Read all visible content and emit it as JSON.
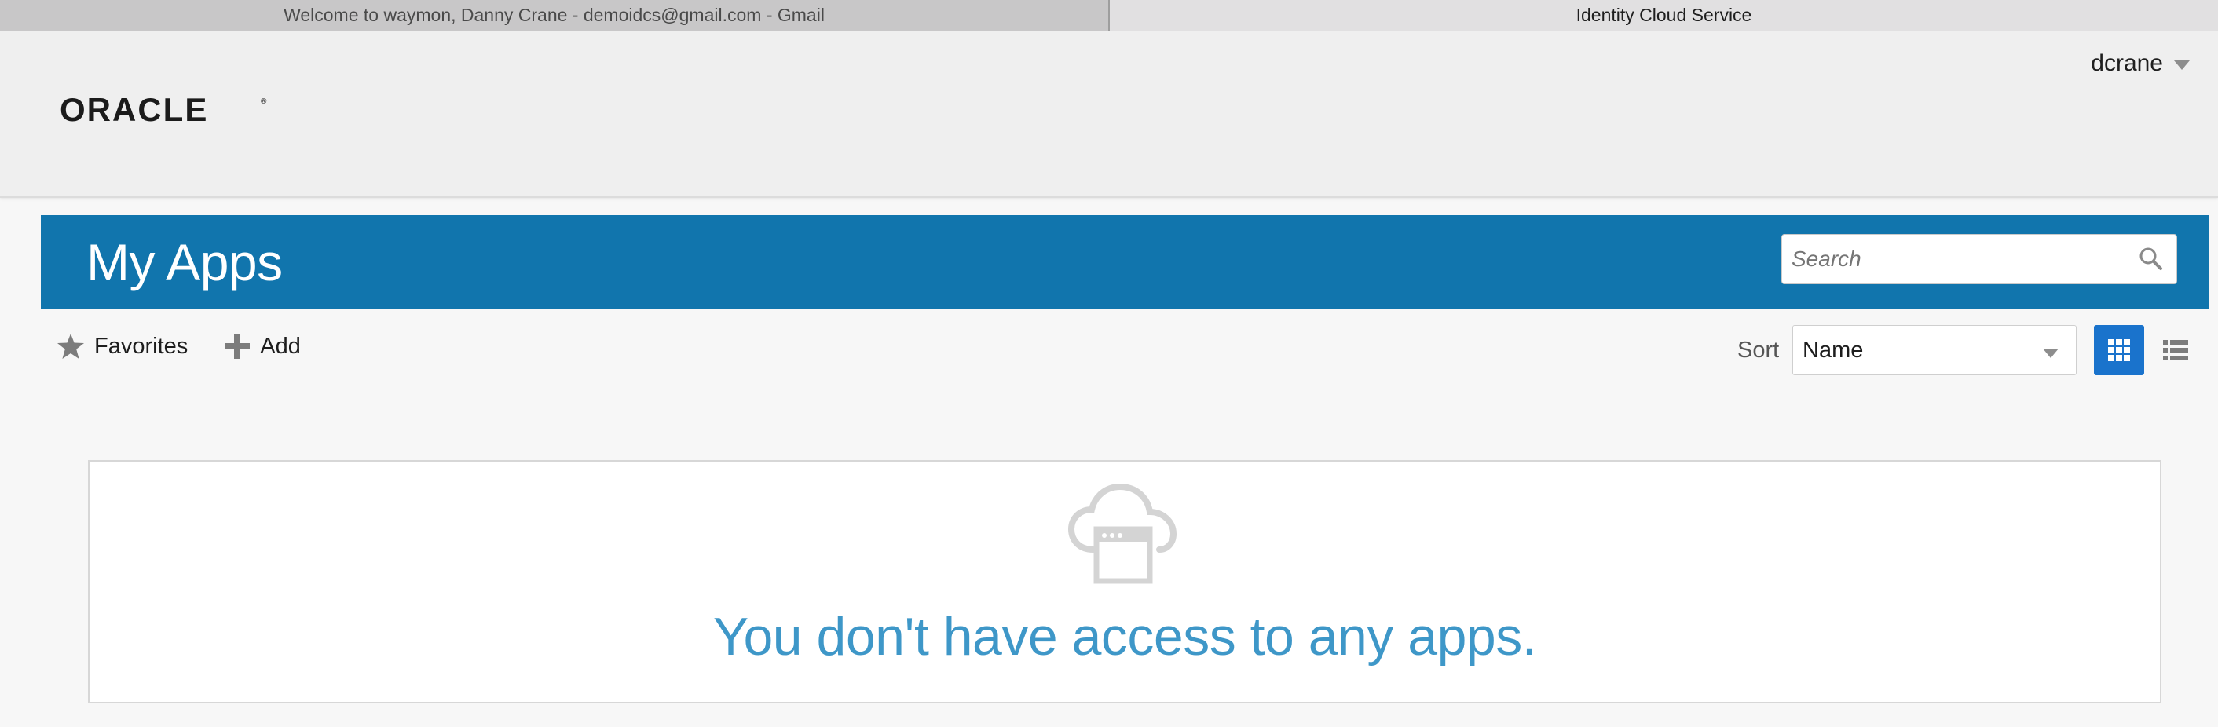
{
  "browser": {
    "tabs": [
      {
        "title": "Welcome to waymon, Danny Crane - demoidcs@gmail.com - Gmail",
        "active": false
      },
      {
        "title": "Identity Cloud Service",
        "active": true
      }
    ]
  },
  "header": {
    "logo_text": "ORACLE",
    "user": {
      "name": "dcrane"
    }
  },
  "banner": {
    "title": "My Apps",
    "search": {
      "placeholder": "Search",
      "icon": "search-icon"
    },
    "color": "#1175ad"
  },
  "toolbar": {
    "favorites_label": "Favorites",
    "add_label": "Add",
    "sort_label": "Sort",
    "sort_value": "Name",
    "view_mode": "grid"
  },
  "empty_state": {
    "message": "You don't have access to any apps.",
    "icon": "cloud-app-icon",
    "color": "#3e97c8"
  }
}
